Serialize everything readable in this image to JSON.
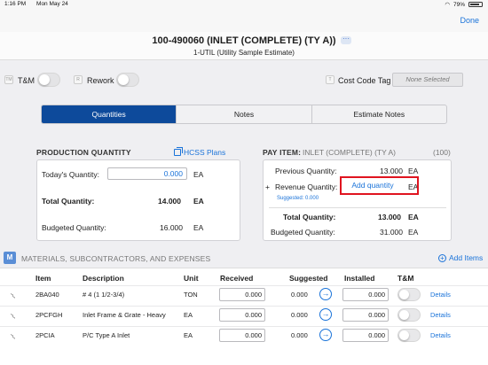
{
  "status_bar": {
    "time": "1:16 PM",
    "date": "Mon May 24",
    "battery": "79%"
  },
  "nav": {
    "done_label": "Done"
  },
  "header": {
    "title": "100-490060 (INLET (COMPLETE) (TY A))",
    "subtitle": "1-UTIL (Utility Sample Estimate)"
  },
  "toggles": {
    "tm_tag": "TM",
    "tm_label": "T&M",
    "rework_tag": "R",
    "rework_label": "Rework",
    "cost_tag": "T",
    "cost_code_label": "Cost Code Tag",
    "cost_code_value": "None Selected"
  },
  "tabs": [
    "Quantities",
    "Notes",
    "Estimate Notes"
  ],
  "production": {
    "title": "PRODUCTION QUANTITY",
    "plans_link": "HCSS Plans",
    "todays_label": "Today's Quantity:",
    "todays_value": "0.000",
    "todays_unit": "EA",
    "total_label": "Total Quantity:",
    "total_value": "14.000",
    "total_unit": "EA",
    "budgeted_label": "Budgeted Quantity:",
    "budgeted_value": "16.000",
    "budgeted_unit": "EA"
  },
  "pay_item": {
    "title_prefix": "PAY ITEM:",
    "title_value": "INLET (COMPLETE) (TY A)",
    "count": "(100)",
    "previous_label": "Previous Quantity:",
    "previous_value": "13.000",
    "previous_unit": "EA",
    "plus": "+",
    "revenue_label": "Revenue Quantity:",
    "add_quantity_placeholder": "Add quantity",
    "revenue_unit": "EA",
    "suggested": "Suggested: 0.000",
    "total_label": "Total Quantity:",
    "total_value": "13.000",
    "total_unit": "EA",
    "budgeted_label": "Budgeted Quantity:",
    "budgeted_value": "31.000",
    "budgeted_unit": "EA"
  },
  "materials": {
    "badge": "M",
    "title": "MATERIALS, SUBCONTRACTORS, AND EXPENSES",
    "add_items_label": "Add Items",
    "columns": [
      "Item",
      "Description",
      "Unit",
      "Received",
      "Suggested",
      "Installed",
      "T&M"
    ],
    "rows": [
      {
        "item": "2BA040",
        "description": "# 4 (1 1/2-3/4)",
        "unit": "TON",
        "received": "0.000",
        "suggested": "0.000",
        "installed": "0.000",
        "details": "Details"
      },
      {
        "item": "2PCFGH",
        "description": "Inlet Frame & Grate - Heavy",
        "unit": "EA",
        "received": "0.000",
        "suggested": "0.000",
        "installed": "0.000",
        "details": "Details"
      },
      {
        "item": "2PCIA",
        "description": "P/C Type A Inlet",
        "unit": "EA",
        "received": "0.000",
        "suggested": "0.000",
        "installed": "0.000",
        "details": "Details"
      }
    ]
  }
}
